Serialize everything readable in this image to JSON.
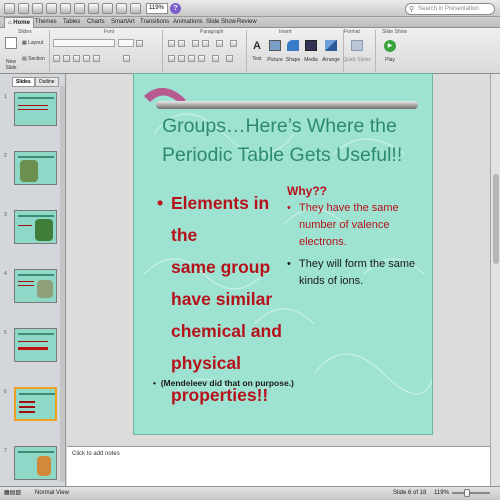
{
  "toolbar": {
    "zoom": "119%",
    "search_placeholder": "Search in Presentation",
    "help": "?"
  },
  "tabs": [
    "Home",
    "Themes",
    "Tables",
    "Charts",
    "SmartArt",
    "Transitions",
    "Animations",
    "Slide Show",
    "Review"
  ],
  "ribbon": {
    "groups": [
      "Slides",
      "Font",
      "Paragraph",
      "Insert",
      "Format",
      "Slide Show"
    ],
    "new_slide": "New Slide",
    "layout": "Layout",
    "section": "Section",
    "insert_items": [
      "Text",
      "Picture",
      "Shape",
      "Media",
      "Arrange"
    ],
    "quick_styles": "Quick Styles",
    "play": "Play"
  },
  "pane_tabs": [
    "Slides",
    "Outline"
  ],
  "thumbnails": [
    {
      "num": "1"
    },
    {
      "num": "2"
    },
    {
      "num": "3"
    },
    {
      "num": "4"
    },
    {
      "num": "5"
    },
    {
      "num": "6"
    },
    {
      "num": "7"
    }
  ],
  "slide": {
    "title": "Groups…Here’s Where the Periodic Table Gets Useful!!",
    "left_bullet": "Elements in the same group have similar chemical and physical properties!!",
    "left_lines": [
      "Elements in the",
      "same group",
      "have similar",
      "chemical and",
      "physical",
      "properties!!"
    ],
    "left_sub": "(Mendeleev did that on purpose.)",
    "why": "Why??",
    "right_bullets": [
      {
        "lines": [
          "They have the same",
          "number of valence",
          "electrons."
        ]
      },
      {
        "lines": [
          "They will form the same",
          "kinds of ions."
        ]
      }
    ],
    "bullet_char": "•"
  },
  "notes_placeholder": "Click to add notes",
  "status": {
    "view": "Normal View",
    "slide": "Slide 6 of 18",
    "zoom": "119%"
  },
  "colors": {
    "slide_bg": "#9ee3d2",
    "title": "#2e8a6e",
    "bullet_red": "#b5121b"
  }
}
